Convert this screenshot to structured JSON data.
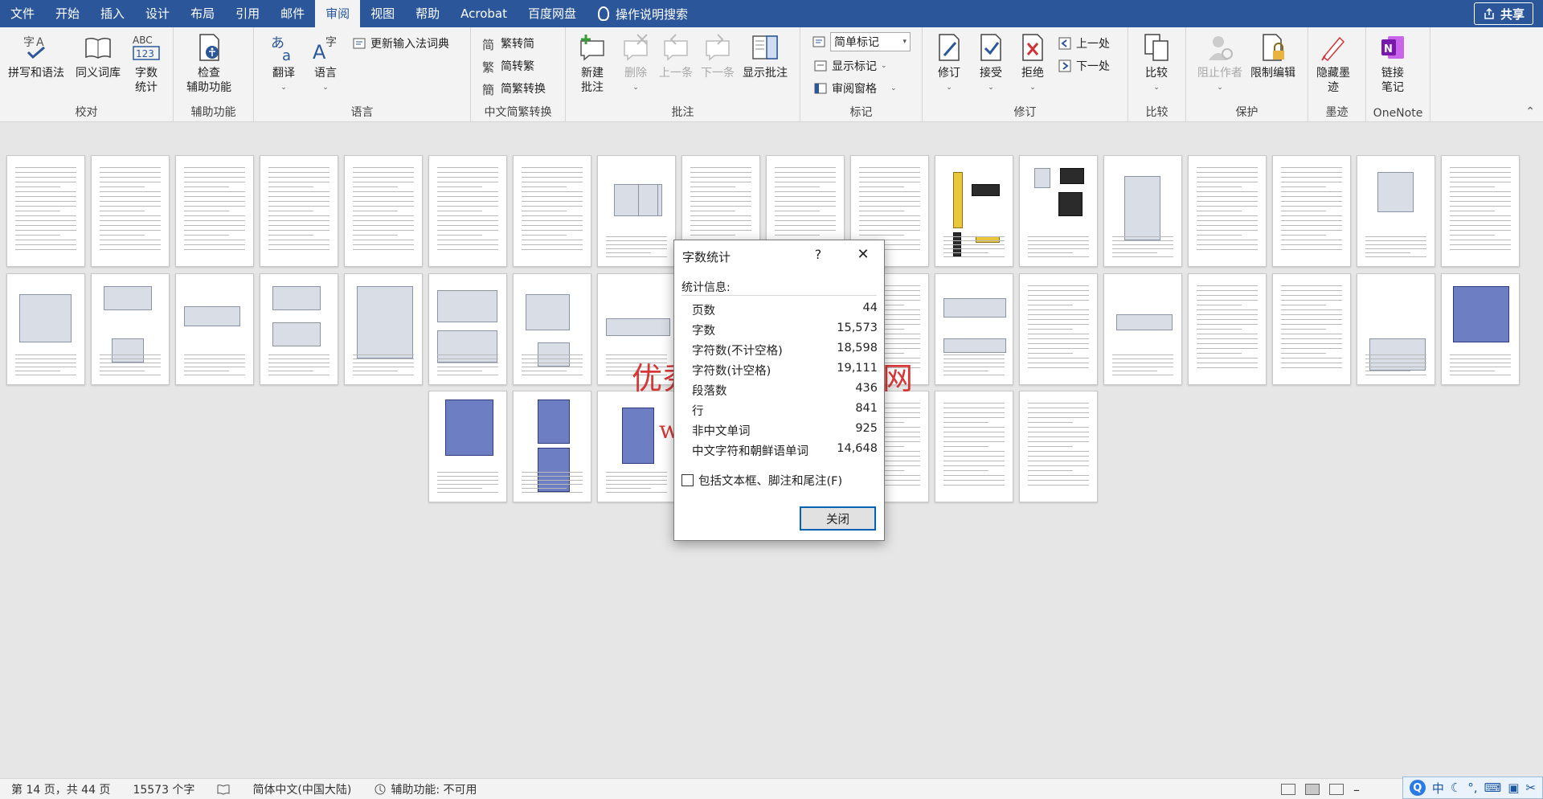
{
  "menubar": {
    "tabs": [
      "文件",
      "开始",
      "插入",
      "设计",
      "布局",
      "引用",
      "邮件",
      "审阅",
      "视图",
      "帮助",
      "Acrobat",
      "百度网盘"
    ],
    "active_tab": "审阅",
    "search_label": "操作说明搜索",
    "share_label": "共享"
  },
  "ribbon": {
    "proofing": {
      "label": "校对",
      "spell": "拼写和语法",
      "thesaurus": "同义词库",
      "wordcount_line1": "字数",
      "wordcount_line2": "统计"
    },
    "accessibility": {
      "label": "辅助功能",
      "check_line1": "检查",
      "check_line2": "辅助功能"
    },
    "language": {
      "label": "语言",
      "translate": "翻译",
      "language": "语言",
      "update_ime": "更新输入法词典"
    },
    "chinese_conversion": {
      "label": "中文简繁转换",
      "to_traditional": "繁转简",
      "to_simplified": "简转繁",
      "convert": "简繁转换"
    },
    "comments": {
      "label": "批注",
      "new_line1": "新建",
      "new_line2": "批注",
      "delete": "删除",
      "previous": "上一条",
      "next": "下一条",
      "show": "显示批注"
    },
    "tracking": {
      "label": "标记",
      "markup_combo": "简单标记",
      "show_markup": "显示标记",
      "reviewing_pane": "审阅窗格"
    },
    "changes": {
      "label": "修订",
      "track": "修订",
      "accept": "接受",
      "reject": "拒绝",
      "previous": "上一处",
      "next": "下一处"
    },
    "compare": {
      "label": "比较",
      "compare": "比较"
    },
    "protect": {
      "label": "保护",
      "block_authors": "阻止作者",
      "restrict": "限制编辑"
    },
    "ink": {
      "label": "墨迹",
      "hide_line1": "隐藏墨",
      "hide_line2": "迹"
    },
    "onenote": {
      "label": "OneNote",
      "link_line1": "链接",
      "link_line2": "笔记"
    }
  },
  "watermark": {
    "line1": "优秀毕业设计资源网",
    "line2": "www.heyicad.cn"
  },
  "dialog": {
    "title": "字数统计",
    "help": "?",
    "close_glyph": "✕",
    "stats_label": "统计信息:",
    "stats": [
      {
        "label": "页数",
        "value": "44"
      },
      {
        "label": "字数",
        "value": "15,573"
      },
      {
        "label": "字符数(不计空格)",
        "value": "18,598"
      },
      {
        "label": "字符数(计空格)",
        "value": "19,111"
      },
      {
        "label": "段落数",
        "value": "436"
      },
      {
        "label": "行",
        "value": "841"
      },
      {
        "label": "非中文单词",
        "value": "925"
      },
      {
        "label": "中文字符和朝鲜语单词",
        "value": "14,648"
      }
    ],
    "include_label": "包括文本框、脚注和尾注(F)",
    "close_button": "关闭"
  },
  "statusbar": {
    "page": "第 14 页，共 44 页",
    "words": "15573 个字",
    "language": "简体中文(中国大陆)",
    "accessibility": "辅助功能: 不可用"
  },
  "ime": {
    "logo": "Q",
    "mode": "中"
  }
}
